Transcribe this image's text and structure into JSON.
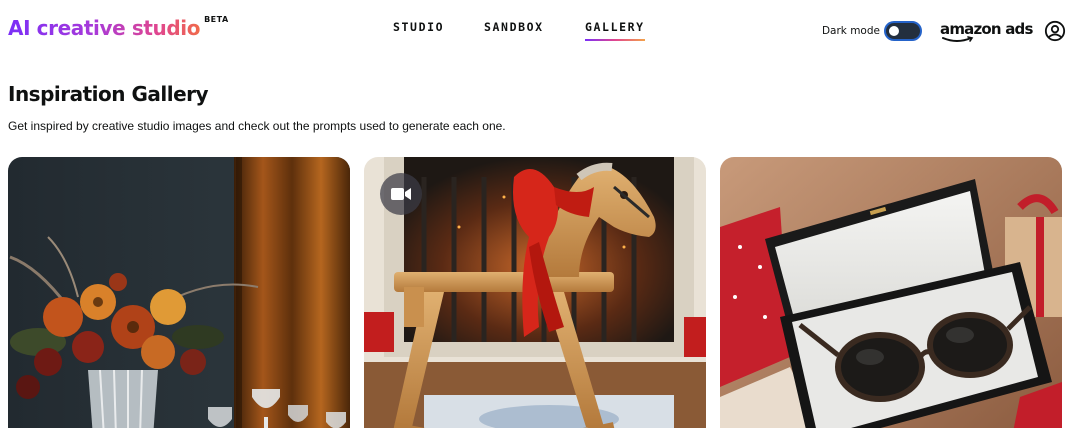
{
  "header": {
    "brand": "AI creative studio",
    "beta": "BETA",
    "nav": [
      {
        "label": "STUDIO",
        "active": false
      },
      {
        "label": "SANDBOX",
        "active": false
      },
      {
        "label": "GALLERY",
        "active": true
      }
    ],
    "dark_mode_label": "Dark mode",
    "dark_mode_on": false,
    "amazon_ads_logo": "amazon ads",
    "account_icon": "user-circle-icon"
  },
  "page": {
    "title": "Inspiration Gallery",
    "subtitle": "Get inspired by creative studio images and check out the prompts used to generate each one."
  },
  "colors": {
    "accent_gradient": [
      "#7b2ff7",
      "#e0468f",
      "#f06a4a"
    ],
    "toggle_border": "#2563c9",
    "toggle_fill": "#232f3e"
  },
  "gallery": [
    {
      "subject": "autumn flower bouquet in crystal vase with glassware",
      "video": false
    },
    {
      "subject": "wooden rocking horse with red bow by fireplace",
      "video": true,
      "badge_icon": "video-camera-icon"
    },
    {
      "subject": "sunglasses in open black gift box",
      "video": false
    }
  ]
}
